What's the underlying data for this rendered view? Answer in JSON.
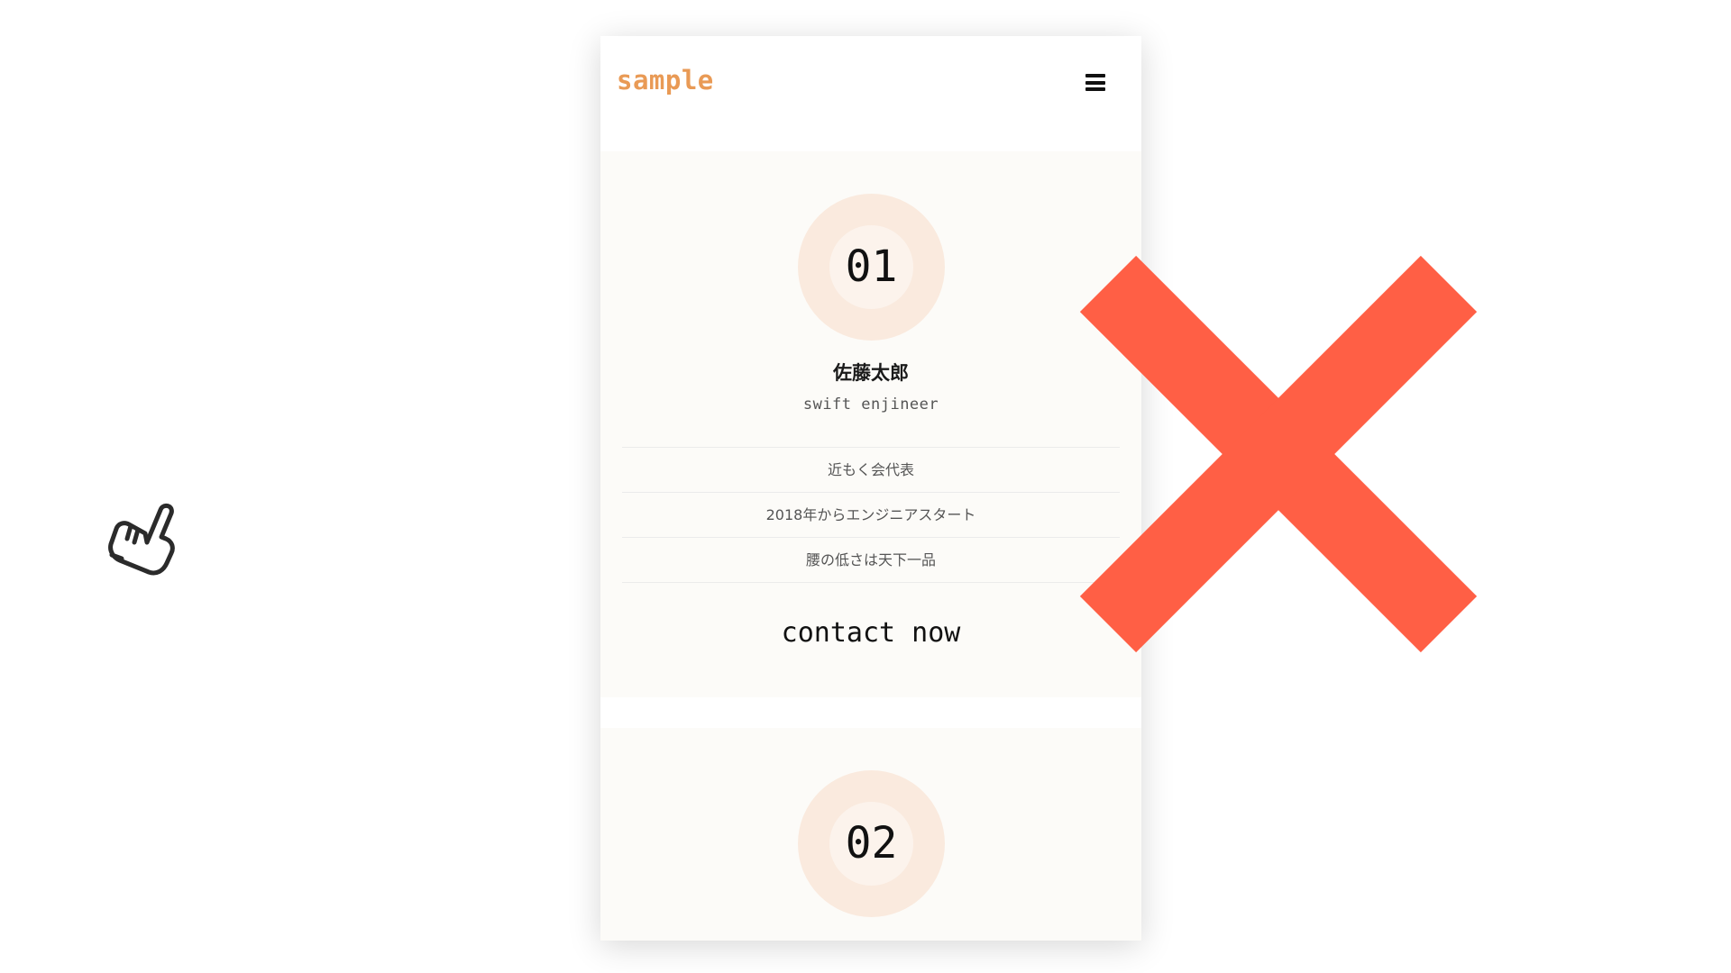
{
  "header": {
    "logo": "sample",
    "menu_icon": "hamburger-menu-icon"
  },
  "profiles": [
    {
      "number": "01",
      "name": "佐藤太郎",
      "role": "swift enjineer",
      "facts": [
        "近もく会代表",
        "2018年からエンジニアスタート",
        "腰の低さは天下一品"
      ],
      "contact_label": "contact now"
    },
    {
      "number": "02",
      "name": ""
    }
  ],
  "overlay": {
    "cursor_icon": "pointing-hand-cursor-icon",
    "mark_icon": "red-cross-x-icon",
    "mark_color": "#ff5f45"
  },
  "colors": {
    "accent": "#e99a55",
    "badge_outer": "#faeade",
    "badge_inner": "#fcf3ec",
    "card_bg": "#fcfbf8",
    "text_dark": "#111111"
  }
}
